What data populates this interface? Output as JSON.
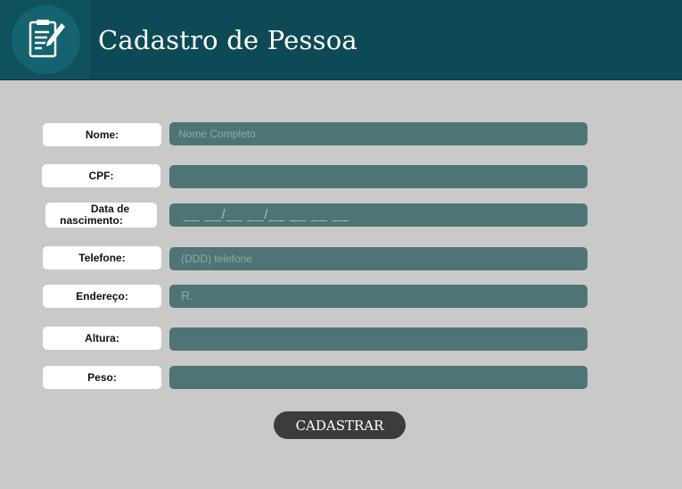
{
  "header": {
    "title": "Cadastro de Pessoa",
    "icon": "form-edit-icon"
  },
  "form": {
    "nome": {
      "label": "Nome:",
      "placeholder": "Nome Completo"
    },
    "cpf": {
      "label": "CPF:",
      "placeholder": ""
    },
    "nascimento": {
      "label_line1": "Data de",
      "label_line2": "nascimento:",
      "placeholder": "__ __/__ __/__ __ __ __"
    },
    "telefone": {
      "label": "Telefone:",
      "placeholder": "(DDD) telefone"
    },
    "endereco": {
      "label": "Endereço:",
      "placeholder": "R."
    },
    "altura": {
      "label": "Altura:",
      "placeholder": ""
    },
    "peso": {
      "label": "Peso:",
      "placeholder": ""
    },
    "submit_label": "CADASTRAR"
  },
  "colors": {
    "header": "#0e4a55",
    "background": "#c9c9c9",
    "field": "#4e7476",
    "button": "#3a3c3d"
  }
}
